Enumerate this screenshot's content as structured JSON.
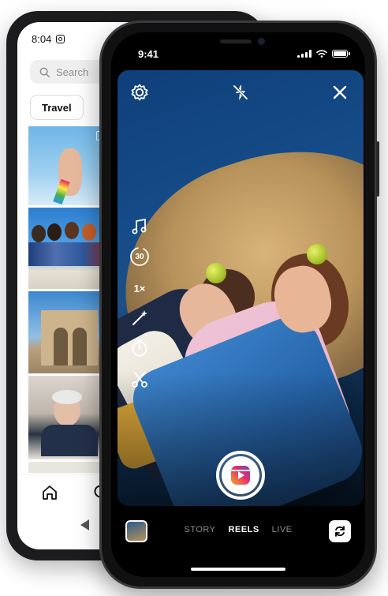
{
  "back_phone": {
    "status_time": "8:04",
    "search_placeholder": "Search",
    "chip_label": "Travel",
    "icons": [
      "instagram-icon",
      "search-icon",
      "home-icon",
      "search-nav-icon",
      "android-back-icon"
    ]
  },
  "front_phone": {
    "status_time": "9:41",
    "top_controls": [
      "settings-icon",
      "flash-off-icon",
      "close-icon"
    ],
    "tools": [
      {
        "name": "audio-icon",
        "label": ""
      },
      {
        "name": "length-icon",
        "label": "30"
      },
      {
        "name": "speed-icon",
        "label": "1×"
      },
      {
        "name": "effects-icon",
        "label": ""
      },
      {
        "name": "timer-icon",
        "label": ""
      },
      {
        "name": "align-icon",
        "label": ""
      }
    ],
    "modes": {
      "story": "STORY",
      "reels": "REELS",
      "live": "LIVE",
      "active": "REELS"
    }
  },
  "colors": {
    "accent_gradient_start": "#f9a825",
    "accent_gradient_mid": "#e1306c",
    "accent_gradient_end": "#833ab4",
    "mode_inactive": "#8e8e8e"
  }
}
